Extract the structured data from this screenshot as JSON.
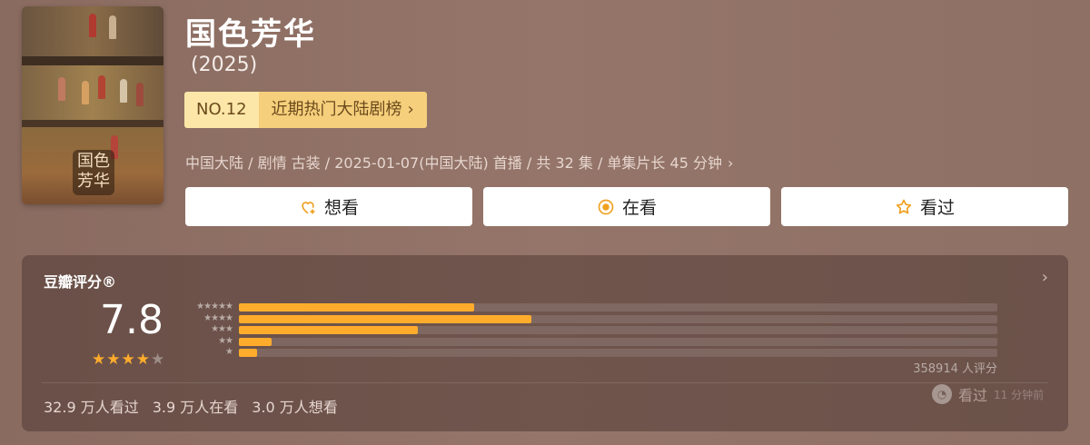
{
  "movie": {
    "title": "国色芳华",
    "year": "(2025)",
    "poster_text": "国色芳华"
  },
  "rank": {
    "no": "NO.12",
    "label": "近期热门大陆剧榜",
    "chevron": "›"
  },
  "meta": {
    "text": "中国大陆 / 剧情 古装 / 2025-01-07(中国大陆) 首播 / 共 32 集 / 单集片长 45 分钟",
    "chevron": "›"
  },
  "actions": [
    {
      "label": "想看",
      "icon": "heart-plus-icon"
    },
    {
      "label": "在看",
      "icon": "target-circle-icon"
    },
    {
      "label": "看过",
      "icon": "star-outline-icon"
    }
  ],
  "rating": {
    "title": "豆瓣评分®",
    "score": "7.8",
    "stars": 4,
    "distribution": [
      {
        "stars": "★★★★★",
        "fraction": 0.31
      },
      {
        "stars": "★★★★",
        "fraction": 0.386
      },
      {
        "stars": "★★★",
        "fraction": 0.236
      },
      {
        "stars": "★★",
        "fraction": 0.043
      },
      {
        "stars": "★",
        "fraction": 0.024
      }
    ],
    "count": "358914 人评分",
    "arrow": "›"
  },
  "stats": {
    "watched": "32.9 万人看过",
    "watching": "3.9 万人在看",
    "want": "3.0 万人想看"
  },
  "friend": {
    "action": "看过",
    "time": "11 分钟前"
  },
  "colors": {
    "accent": "#ffac2d",
    "rank_bg": "#f6cf7c",
    "rank_no_bg": "#fde7a8"
  }
}
